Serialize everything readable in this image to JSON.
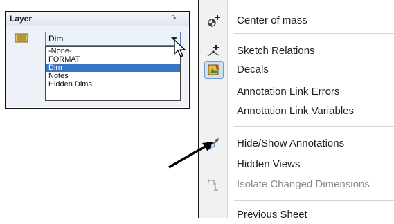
{
  "layer_panel": {
    "title": "Layer",
    "collapse_icon": "double-chevron-up-icon",
    "folder_icon": "layer-folder-icon",
    "selected_value": "Dim",
    "options": [
      "-None-",
      "FORMAT",
      "Dim",
      "Notes",
      "Hidden Dims"
    ],
    "selected_index": 2,
    "accent_color": "#3a74c4"
  },
  "context_menu": {
    "items": [
      {
        "label": "Center of mass",
        "icon": "center-of-mass-icon",
        "enabled": true
      },
      {
        "label": "Sketch Relations",
        "icon": "sketch-relations-icon",
        "enabled": true
      },
      {
        "label": "Decals",
        "icon": "decals-icon",
        "enabled": true
      },
      {
        "label": "Annotation Link Errors",
        "icon": "",
        "enabled": true
      },
      {
        "label": "Annotation Link Variables",
        "icon": "",
        "enabled": true
      },
      {
        "label": "Hide/Show Annotations",
        "icon": "hide-show-annotations-icon",
        "enabled": true
      },
      {
        "label": "Hidden Views",
        "icon": "",
        "enabled": true
      },
      {
        "label": "Isolate Changed Dimensions",
        "icon": "isolate-dimensions-icon",
        "enabled": false
      },
      {
        "label": "Previous Sheet",
        "icon": "",
        "enabled": true
      }
    ]
  },
  "callout": {
    "icon": "callout-arrow-icon"
  }
}
